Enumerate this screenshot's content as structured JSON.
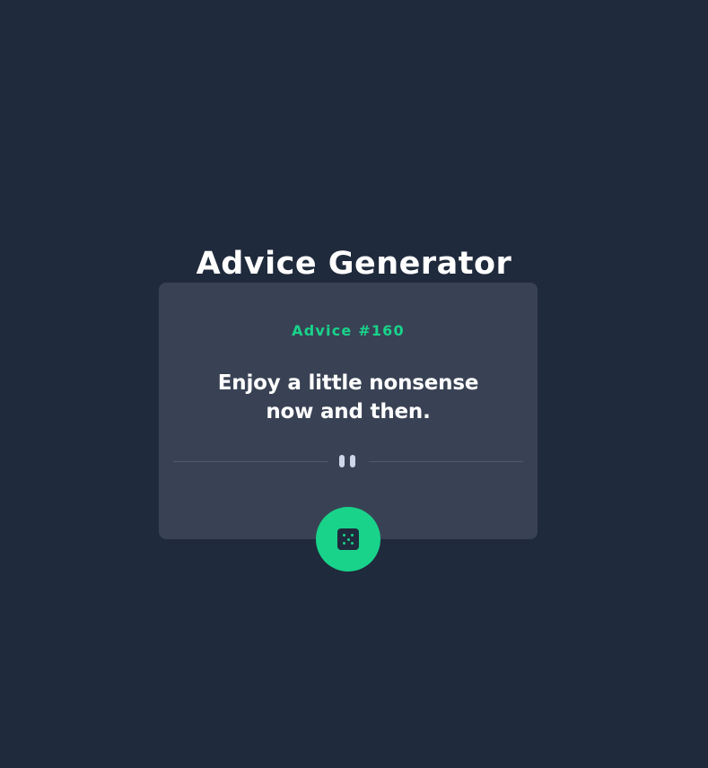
{
  "header": {
    "title": "Advice Generator"
  },
  "advice": {
    "number_label": "Advice #160",
    "quote": "Enjoy a little nonsense now and then."
  },
  "controls": {
    "generate_icon": "dice-icon"
  },
  "colors": {
    "background": "#1f2a3c",
    "card": "#394254",
    "accent": "#19d38b",
    "divider": "#4f5a6d",
    "text": "#ffffff"
  }
}
